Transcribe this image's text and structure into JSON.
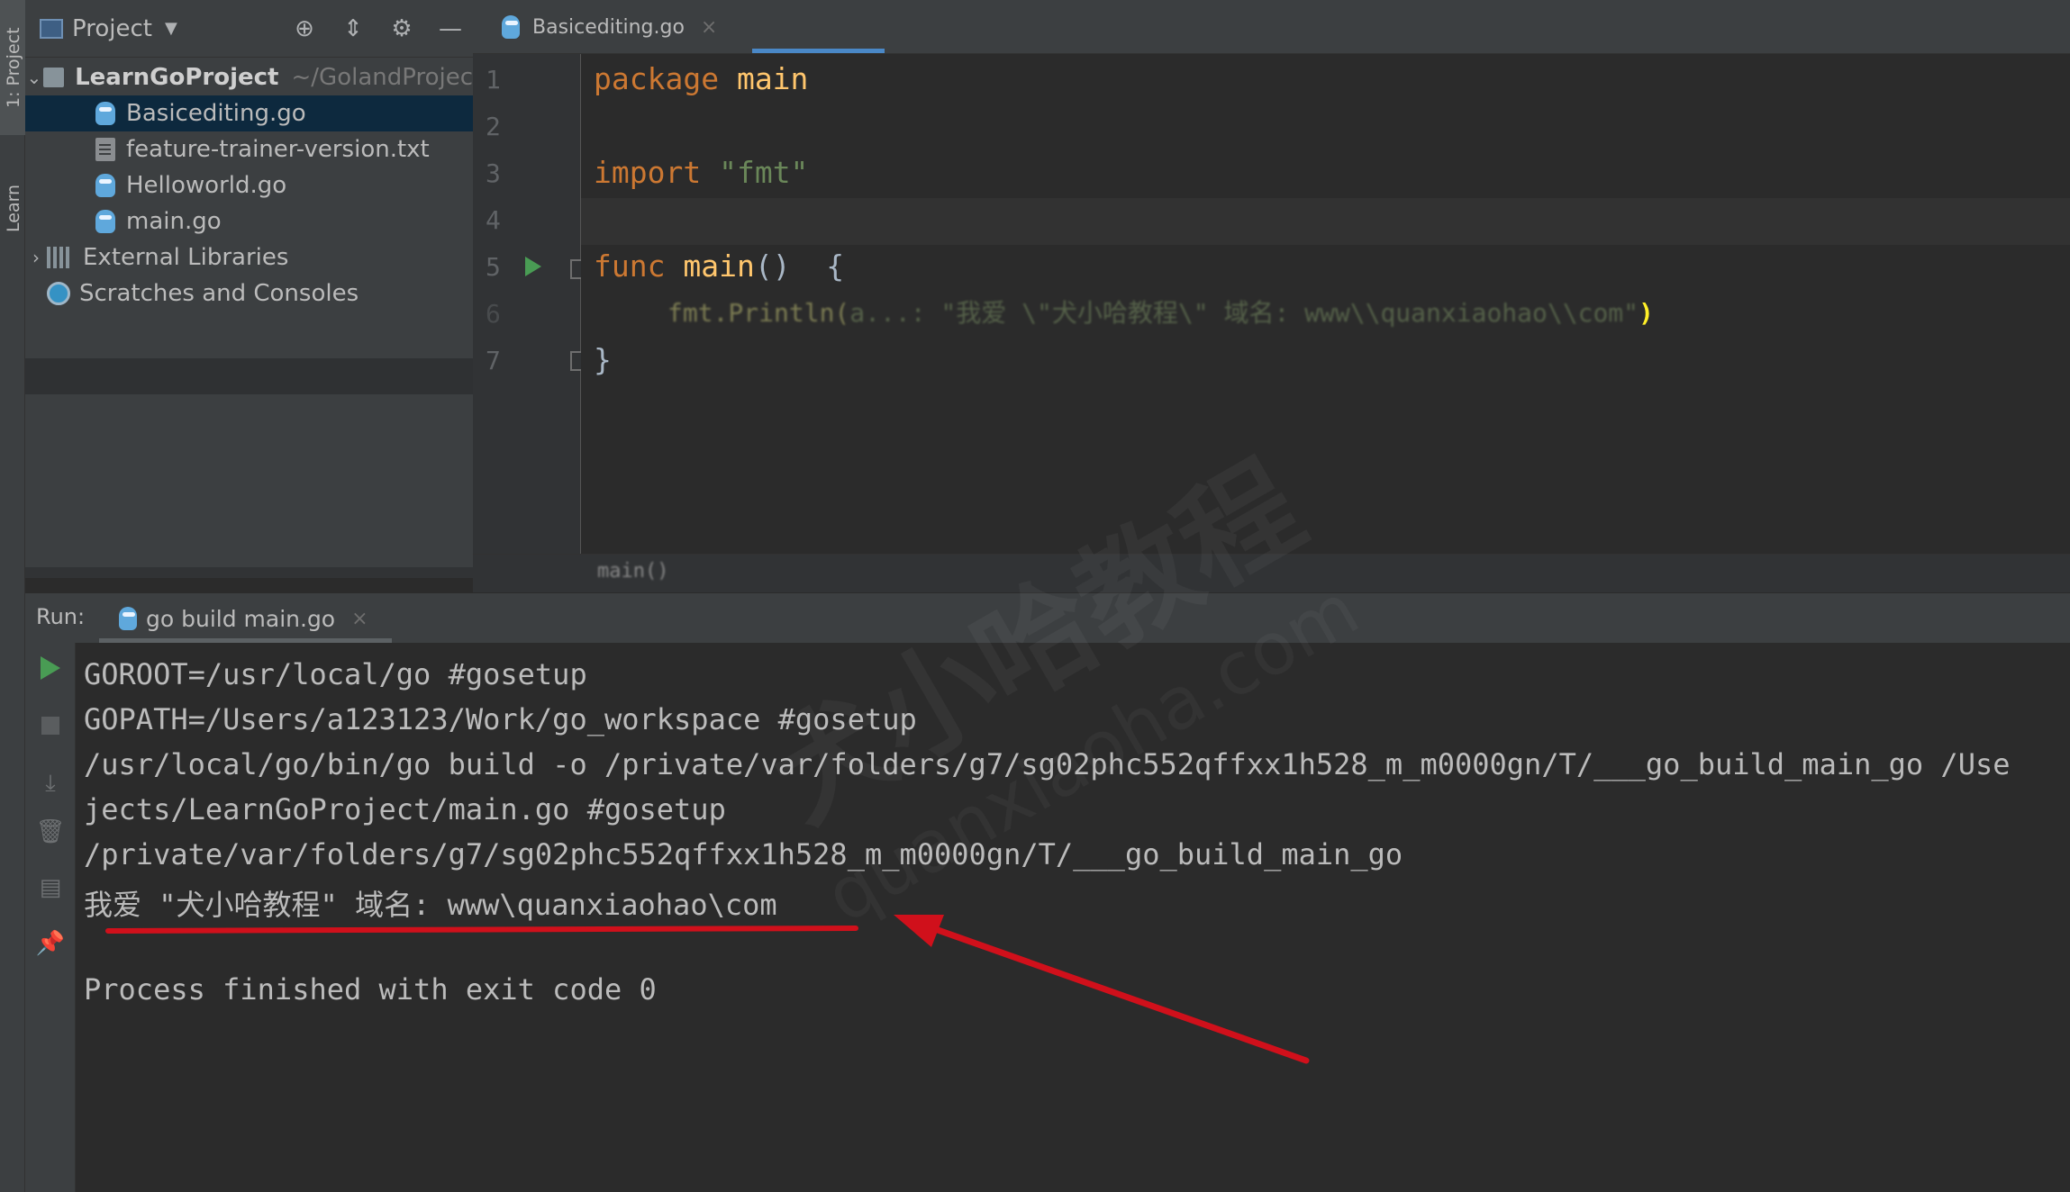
{
  "side_tabs": {
    "project": "1: Project",
    "learn": "Learn"
  },
  "project_panel": {
    "title": "Project",
    "tree": [
      {
        "label": "LearnGoProject",
        "path": "~/GolandProjec",
        "type": "folder"
      },
      {
        "label": "Basicediting.go",
        "type": "go"
      },
      {
        "label": "feature-trainer-version.txt",
        "type": "txt"
      },
      {
        "label": "Helloworld.go",
        "type": "go"
      },
      {
        "label": "main.go",
        "type": "go"
      },
      {
        "label": "External Libraries",
        "type": "libs"
      },
      {
        "label": "Scratches and Consoles",
        "type": "scratch"
      }
    ]
  },
  "editor": {
    "tab": {
      "label": "Basicediting.go"
    },
    "line_numbers": [
      "1",
      "2",
      "3",
      "4",
      "5",
      "6",
      "7"
    ],
    "code": {
      "l1_kw": "package",
      "l1_rest": " main",
      "l3_kw": "import",
      "l3_str": " \"fmt\"",
      "l5_kw": "func",
      "l5_fn": " main",
      "l5_rest": "()  {",
      "l6_obscured": "fmt.Println(",
      "l6_args": "a...: \"我爱 \\\"犬小哈教程\\\" 域名: www\\\\quanxiaohao\\\\com\"",
      "l6_close": ")",
      "l7": "}"
    },
    "breadcrumb": "main()"
  },
  "run": {
    "label": "Run:",
    "tab": {
      "label": "go build main.go"
    },
    "console_lines": [
      "GOROOT=/usr/local/go #gosetup",
      "GOPATH=/Users/a123123/Work/go_workspace #gosetup",
      "/usr/local/go/bin/go build -o /private/var/folders/g7/sg02phc552qffxx1h528_m_m0000gn/T/___go_build_main_go /Use",
      "jects/LearnGoProject/main.go #gosetup",
      "/private/var/folders/g7/sg02phc552qffxx1h528_m_m0000gn/T/___go_build_main_go",
      "我爱 \"犬小哈教程\" 域名: www\\quanxiaohao\\com",
      "",
      "Process finished with exit code 0"
    ]
  },
  "annotation": {
    "color": "#d0101b",
    "watermark": "犬小哈教程",
    "watermark_url": "quanxiaoha.com"
  },
  "colors": {
    "keyword": "#cc7832",
    "function": "#ffc66d",
    "string": "#6a8759",
    "selection": "#0d293e",
    "run_green": "#499c54",
    "accent_blue": "#4a88c7"
  }
}
